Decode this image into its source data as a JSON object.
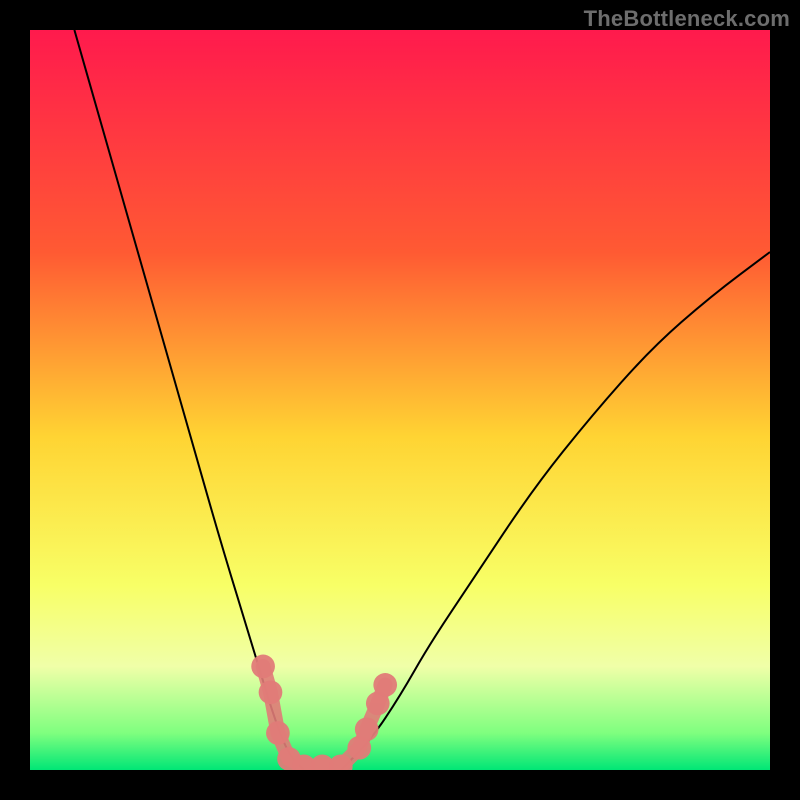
{
  "watermark": "TheBottleneck.com",
  "chart_data": {
    "type": "line",
    "title": "",
    "xlabel": "",
    "ylabel": "",
    "xlim": [
      0,
      100
    ],
    "ylim": [
      0,
      100
    ],
    "grid": false,
    "legend": false,
    "gradient_stops": [
      {
        "offset": 0,
        "color": "#ff1a4d"
      },
      {
        "offset": 30,
        "color": "#ff5a33"
      },
      {
        "offset": 55,
        "color": "#ffd433"
      },
      {
        "offset": 75,
        "color": "#f8ff66"
      },
      {
        "offset": 86,
        "color": "#f0ffa8"
      },
      {
        "offset": 95,
        "color": "#7fff7f"
      },
      {
        "offset": 100,
        "color": "#00e676"
      }
    ],
    "series": [
      {
        "name": "descending-curve",
        "color": "#000000",
        "points": [
          {
            "x": 6,
            "y": 100
          },
          {
            "x": 10,
            "y": 86
          },
          {
            "x": 14,
            "y": 72
          },
          {
            "x": 18,
            "y": 58
          },
          {
            "x": 22,
            "y": 44
          },
          {
            "x": 26,
            "y": 30
          },
          {
            "x": 30,
            "y": 17
          },
          {
            "x": 33,
            "y": 7
          },
          {
            "x": 35,
            "y": 2
          },
          {
            "x": 37,
            "y": 0
          }
        ]
      },
      {
        "name": "ascending-curve",
        "color": "#000000",
        "points": [
          {
            "x": 42,
            "y": 0
          },
          {
            "x": 46,
            "y": 4
          },
          {
            "x": 50,
            "y": 10
          },
          {
            "x": 54,
            "y": 17
          },
          {
            "x": 60,
            "y": 26
          },
          {
            "x": 68,
            "y": 38
          },
          {
            "x": 76,
            "y": 48
          },
          {
            "x": 84,
            "y": 57
          },
          {
            "x": 92,
            "y": 64
          },
          {
            "x": 100,
            "y": 70
          }
        ]
      },
      {
        "name": "sausage-markers",
        "color": "#e07b78",
        "shape": "round",
        "points": [
          {
            "x": 31.5,
            "y": 14
          },
          {
            "x": 32.5,
            "y": 10.5
          },
          {
            "x": 33.5,
            "y": 5
          },
          {
            "x": 35,
            "y": 1.5
          },
          {
            "x": 37,
            "y": 0.5
          },
          {
            "x": 39.5,
            "y": 0.5
          },
          {
            "x": 42,
            "y": 0.5
          },
          {
            "x": 44.5,
            "y": 3
          },
          {
            "x": 45.5,
            "y": 5.5
          },
          {
            "x": 47,
            "y": 9
          },
          {
            "x": 48,
            "y": 11.5
          }
        ]
      }
    ]
  }
}
